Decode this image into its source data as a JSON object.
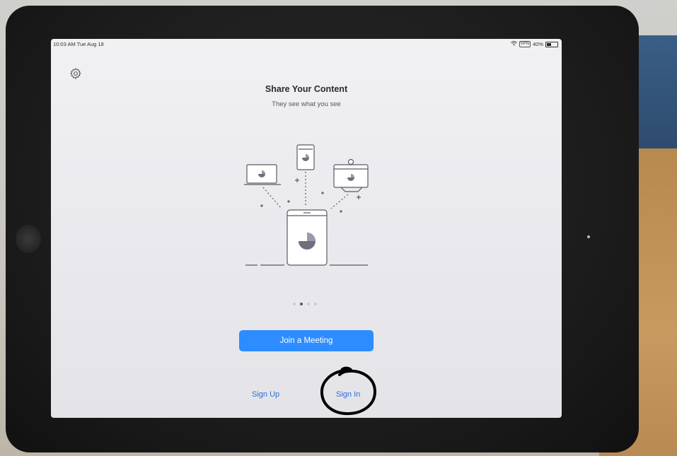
{
  "status_bar": {
    "time": "10:03 AM  Tue Aug 18",
    "vpn": "VPN",
    "battery": "40%",
    "battery_level": 0.4
  },
  "icons": {
    "settings": "gear-icon",
    "wifi": "wifi-icon",
    "battery": "battery-icon"
  },
  "onboarding": {
    "title": "Share Your Content",
    "subtitle": "They see what you see",
    "page_indicator": {
      "count": 4,
      "active_index": 1
    }
  },
  "actions": {
    "join_label": "Join a Meeting",
    "signup_label": "Sign Up",
    "signin_label": "Sign In"
  },
  "colors": {
    "accent": "#2d8cff",
    "link": "#2d6fd6",
    "annotation": "#000000"
  }
}
